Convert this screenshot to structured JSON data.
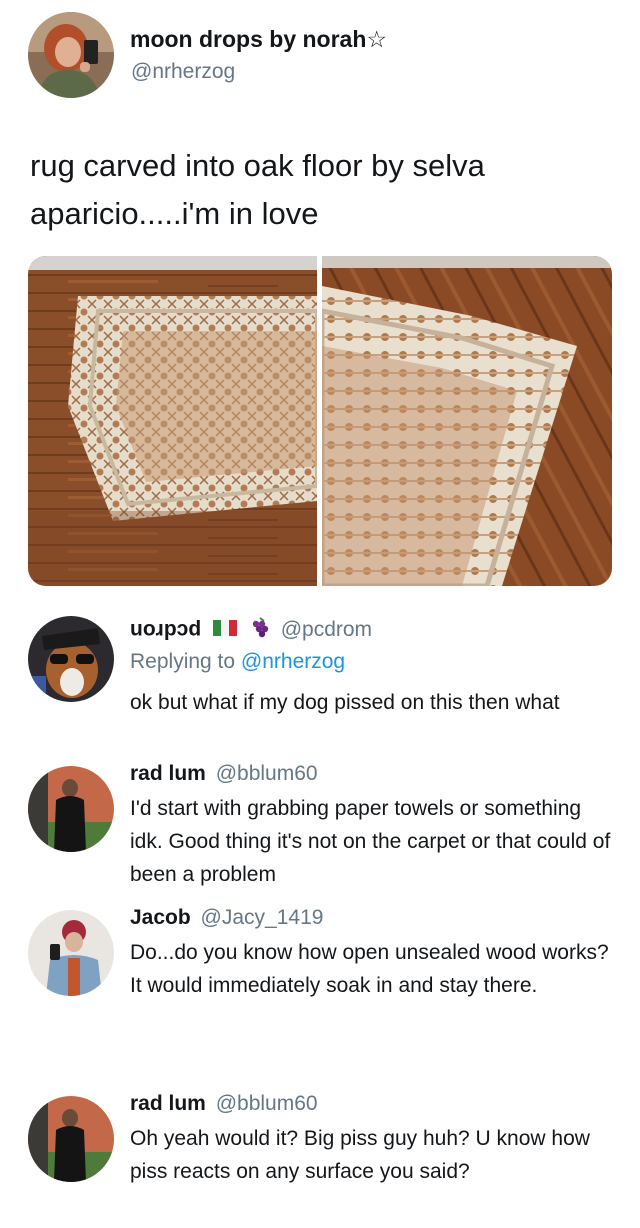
{
  "main_tweet": {
    "display_name": "moon drops by norah☆",
    "handle": "@nrherzog",
    "text": "rug carved into oak floor by selva aparicio.....i'm in love"
  },
  "replies": [
    {
      "display_name": "uoɹpɔd",
      "handle": "@pcdrom",
      "replying_to_prefix": "Replying to",
      "replying_to_handle": "@nrherzog",
      "text": [
        "ok but what if my dog pissed on this then what"
      ]
    },
    {
      "display_name": "rad lum",
      "handle": "@bblum60",
      "text": [
        "I'd start with grabbing paper towels or something idk. Good thing it's not on the carpet or that could of been a problem"
      ]
    },
    {
      "display_name": "Jacob",
      "handle": "@Jacy_1419",
      "text": [
        "Do...do you know how open unsealed wood works?",
        "It would immediately soak in and stay there."
      ]
    },
    {
      "display_name": "rad lum",
      "handle": "@bblum60",
      "text": [
        "Oh yeah would it? Big piss guy huh? U know how piss reacts on any surface you said?"
      ]
    }
  ],
  "colors": {
    "text_primary": "#14171a",
    "text_secondary": "#657786",
    "link": "#1b95e0"
  }
}
